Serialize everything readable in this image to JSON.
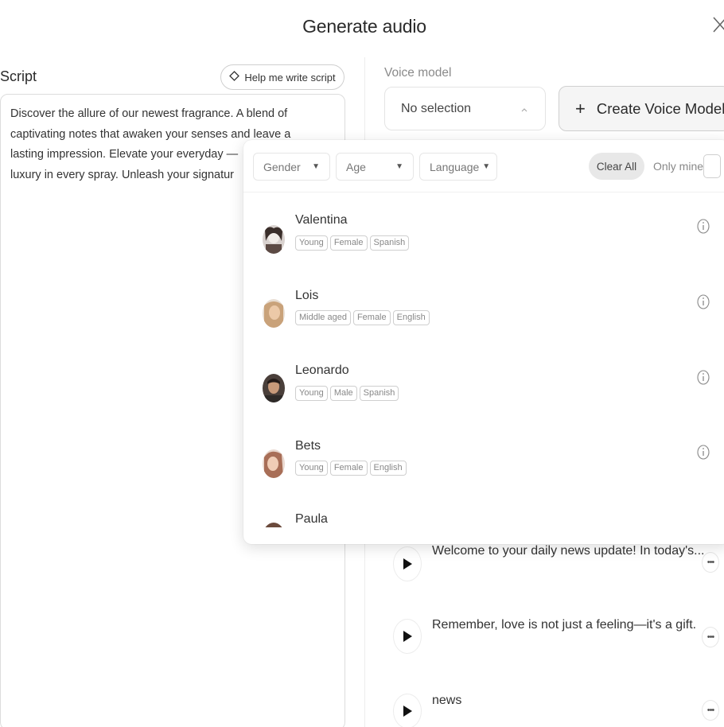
{
  "dialog": {
    "title": "Generate audio",
    "close_icon": "close-icon"
  },
  "script": {
    "label": "Script",
    "help_button": "Help me write script",
    "help_icon": "diamond-sparkle-icon",
    "lines": [
      "Discover the allure of our newest fragrance. A blend of",
      "captivating notes that awaken your senses and leave a",
      "lasting impression. Elevate your everyday —",
      "luxury in every spray. Unleash your signatur"
    ]
  },
  "voice_model": {
    "label": "Voice model",
    "selected": "No selection",
    "create_button": "Create Voice Model",
    "create_icon": "plus-icon"
  },
  "filters": {
    "gender": "Gender",
    "age": "Age",
    "language": "Language",
    "clear_all": "Clear All",
    "only_mine": "Only mine"
  },
  "voices": [
    {
      "name": "Valentina",
      "tags": [
        "Young",
        "Female",
        "Spanish"
      ]
    },
    {
      "name": "Lois",
      "tags": [
        "Middle aged",
        "Female",
        "English"
      ]
    },
    {
      "name": "Leonardo",
      "tags": [
        "Young",
        "Male",
        "Spanish"
      ]
    },
    {
      "name": "Bets",
      "tags": [
        "Young",
        "Female",
        "English"
      ]
    },
    {
      "name": "Paula",
      "tags": []
    }
  ],
  "history": [
    {
      "text": "Welcome to your daily news update! In today's..."
    },
    {
      "text": "Remember, love is not just a feeling—it's a gift."
    },
    {
      "text": "news"
    }
  ],
  "colors": {
    "accent_gray": "#e8e8e8",
    "border": "#dcdcdc"
  }
}
